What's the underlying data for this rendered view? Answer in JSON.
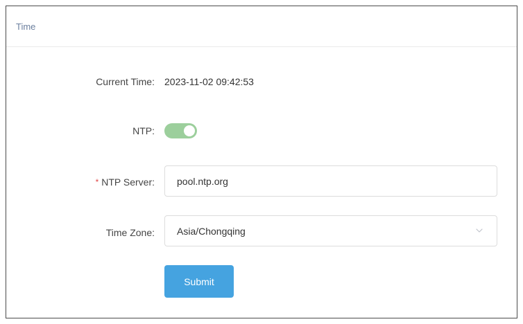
{
  "panel": {
    "title": "Time"
  },
  "form": {
    "current_time": {
      "label": "Current Time:",
      "value": "2023-11-02 09:42:53"
    },
    "ntp": {
      "label": "NTP:",
      "enabled": true
    },
    "ntp_server": {
      "required_mark": "*",
      "label": "NTP Server:",
      "value": "pool.ntp.org"
    },
    "time_zone": {
      "label": "Time Zone:",
      "selected": "Asia/Chongqing",
      "icon": "chevron-down-icon"
    },
    "submit_label": "Submit"
  },
  "colors": {
    "accent": "#45a3e0",
    "toggle_on": "#9ccf9c",
    "required": "#e04848",
    "header_text": "#6b7f9e"
  }
}
